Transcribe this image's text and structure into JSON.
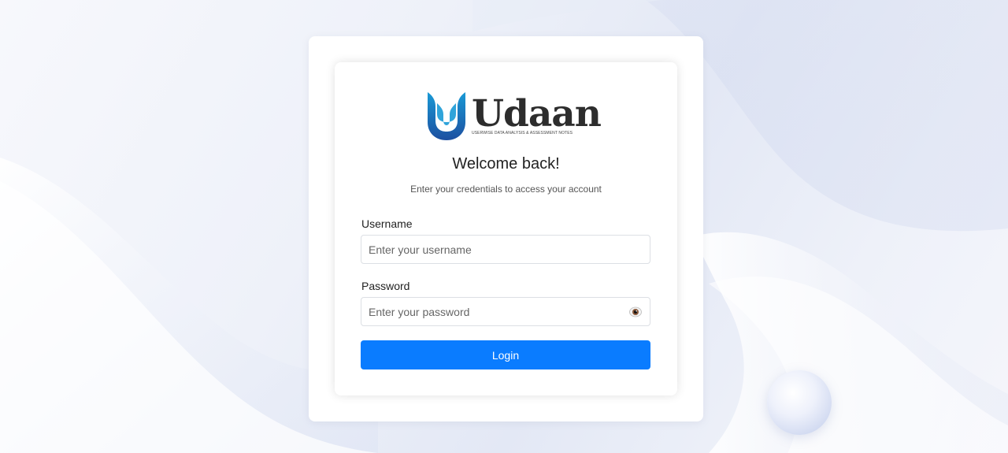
{
  "brand": {
    "name": "Udaan",
    "tagline": "USERWISE DATA ANALYSIS & ASSESSMENT NOTES",
    "logo_icon": "udaan-u-logo-icon",
    "logo_colors": [
      "#1a9ad6",
      "#1c4fa0"
    ]
  },
  "login": {
    "heading": "Welcome back!",
    "subtitle": "Enter your credentials to access your account",
    "username": {
      "label": "Username",
      "placeholder": "Enter your username",
      "value": ""
    },
    "password": {
      "label": "Password",
      "placeholder": "Enter your password",
      "value": "",
      "toggle_icon": "eye-icon"
    },
    "submit_label": "Login"
  },
  "colors": {
    "accent": "#0a7cff",
    "text": "#222222",
    "muted": "#555555"
  }
}
